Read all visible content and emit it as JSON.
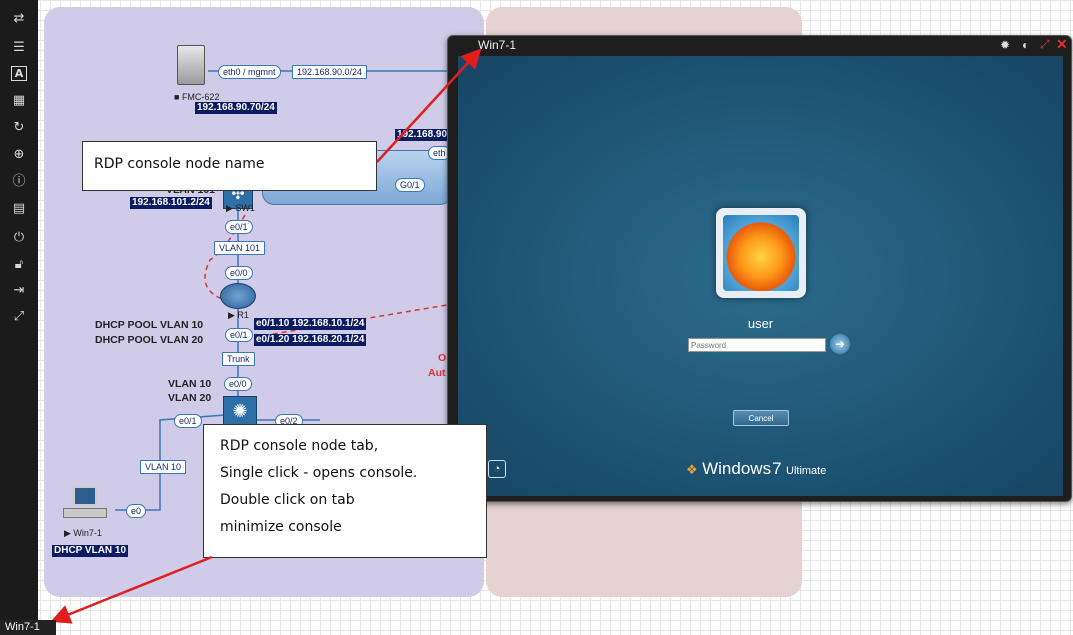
{
  "toolbar": {
    "items": [
      "actions-icon",
      "list-icon",
      "text-icon",
      "grid-icon",
      "refresh-icon",
      "zoom-icon",
      "info-icon",
      "notes-icon",
      "power-icon",
      "unlock-icon",
      "exit-icon",
      "fullscreen-icon"
    ]
  },
  "topology": {
    "fmc": {
      "name": "FMC-622",
      "iface": "eth0 / mgmnt",
      "net": "192.168.90.0/24",
      "ip": "192.168.90.70/24"
    },
    "router_top": {
      "ip_partial": "192.168.90",
      "iface_partial": "eth",
      "g01": "G0/1"
    },
    "sw1": {
      "name": "SW1",
      "vlan": "VLAN 101",
      "ip": "192.168.101.2/24",
      "e01": "e0/1",
      "vlan_label": "VLAN 101"
    },
    "r1": {
      "name": "R1",
      "e00": "e0/0",
      "e01": "e0/1",
      "sub1": "e0/1.10 192.168.10.1/24",
      "sub2": "e0/1.20 192.168.20.1/24",
      "pool1": "DHCP POOL VLAN 10",
      "pool2": "DHCP POOL VLAN 20"
    },
    "trunk": "Trunk",
    "sw2": {
      "vlan10": "VLAN 10",
      "vlan20": "VLAN 20",
      "e00": "e0/0",
      "e01": "e0/1",
      "e02": "e0/2"
    },
    "win7": {
      "name": "Win7-1",
      "e0": "e0",
      "vlan": "VLAN 10",
      "dhcp": "DHCP VLAN 10"
    },
    "partial_text": {
      "o": "O",
      "aut": "Aut"
    }
  },
  "callouts": {
    "node_name": "RDP console node name",
    "node_tab_line1": "RDP console node tab,",
    "node_tab_line2": "Single click - opens console.",
    "node_tab_line3": "Double click on tab",
    "node_tab_line4": "minimize console"
  },
  "console": {
    "title": "Win7-1",
    "user": "user",
    "password_placeholder": "Password",
    "cancel": "Cancel",
    "windows_brand": "Windows",
    "windows_version": "7",
    "windows_edition": "Ultimate"
  },
  "bottom_tab": {
    "label": "Win7-1"
  },
  "colors": {
    "toolbar": "#1b1b1b",
    "lab_region": "#cfcbe8",
    "right_region": "#e4d3d1",
    "screen": "#1e5474",
    "arrow": "#e01e1e"
  }
}
